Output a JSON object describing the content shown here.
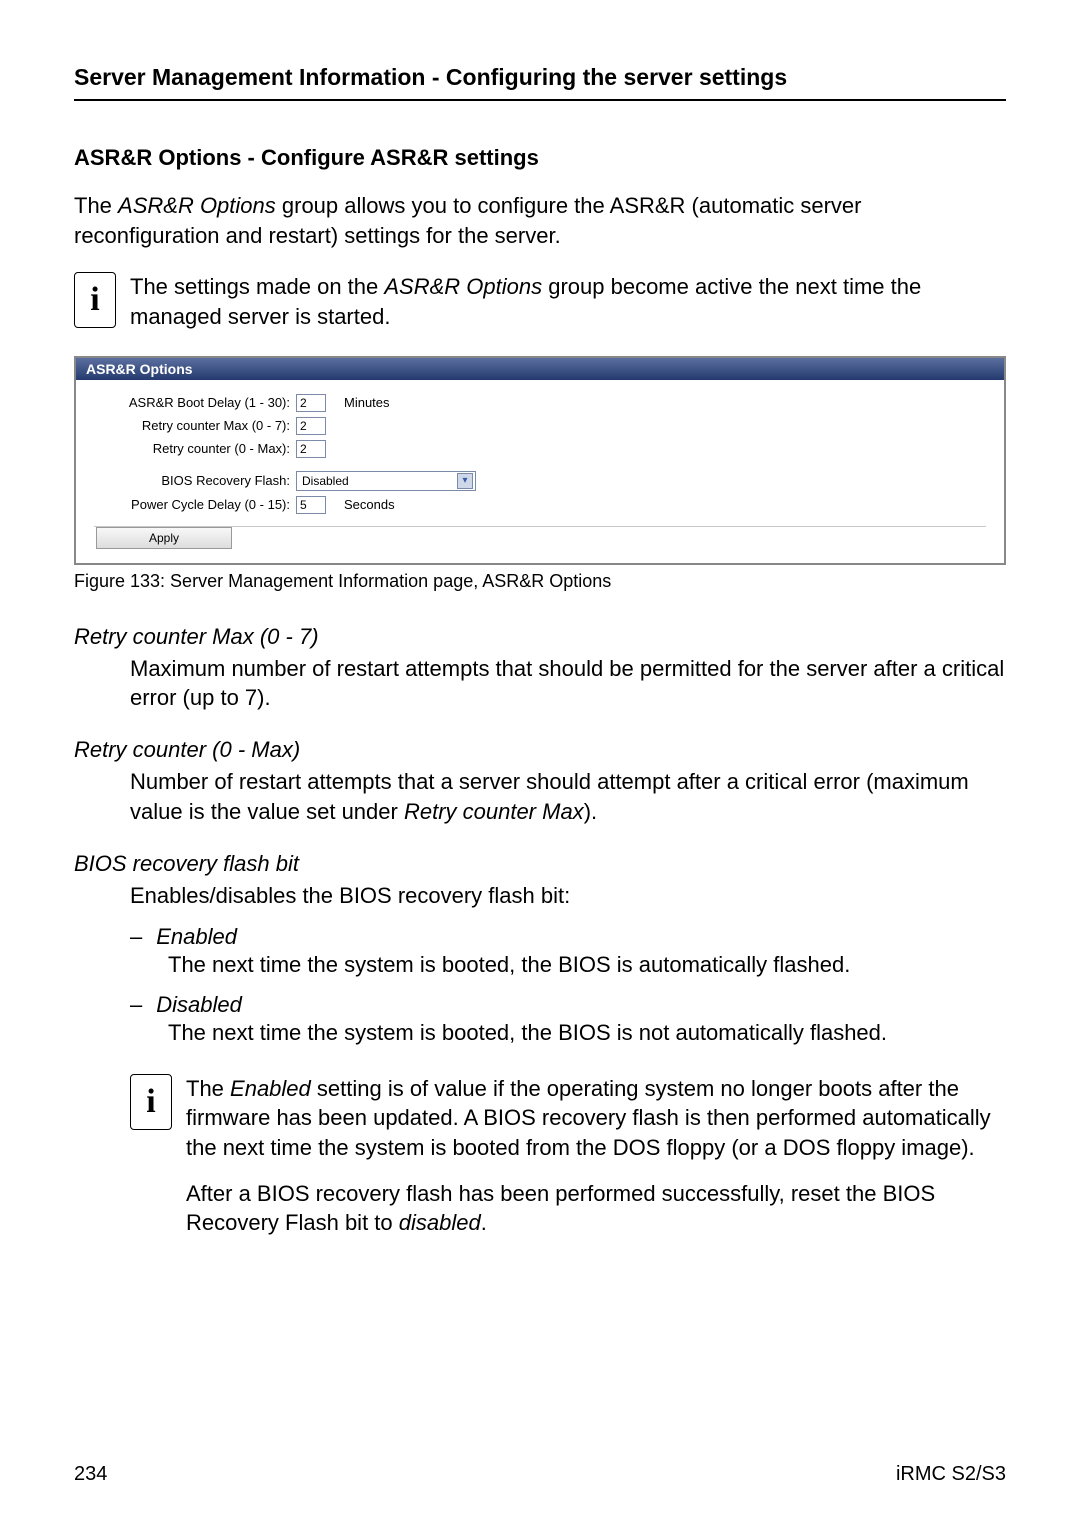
{
  "header": {
    "title": "Server Management Information - Configuring the server settings"
  },
  "section": {
    "title": "ASR&R Options - Configure ASR&R settings"
  },
  "intro": {
    "lead": "The ",
    "italic": "ASR&R Options",
    "rest": "  group allows you to configure the ASR&R (automatic server reconfiguration and restart) settings for the server."
  },
  "note1": {
    "pre": "The settings made on the ",
    "italic": "ASR&R Options",
    "post": " group become active the next time the managed server is started."
  },
  "figure": {
    "titlebar": "ASR&R Options",
    "rows": {
      "boot_delay_label": "ASR&R Boot Delay (1 - 30):",
      "boot_delay_value": "2",
      "boot_delay_unit": "Minutes",
      "retry_max_label": "Retry counter Max (0 - 7):",
      "retry_max_value": "2",
      "retry_label": "Retry counter (0 - Max):",
      "retry_value": "2",
      "bios_label": "BIOS Recovery Flash:",
      "bios_value": "Disabled",
      "power_label": "Power Cycle Delay (0 - 15):",
      "power_value": "5",
      "power_unit": "Seconds"
    },
    "apply": "Apply"
  },
  "caption": "Figure 133: Server Management Information page, ASR&R Options",
  "terms": {
    "retry_max": {
      "label": "Retry counter Max (0 - 7)",
      "def": "Maximum number of restart attempts that should be permitted for the server after a critical error (up to 7)."
    },
    "retry": {
      "label": "Retry counter (0 - Max)",
      "def_pre": "Number of restart attempts that a server should attempt after a critical error (maximum value is the value set under ",
      "def_italic": "Retry counter Max",
      "def_post": ")."
    },
    "bios": {
      "label": "BIOS recovery flash bit",
      "def": "Enables/disables the BIOS recovery flash bit:",
      "enabled_label": "Enabled",
      "enabled_text": "The next time the system is booted, the BIOS is automatically flashed.",
      "disabled_label": "Disabled",
      "disabled_text": "The next time the system is booted, the BIOS is not automatically flashed.",
      "note_pre": "The ",
      "note_italic1": "Enabled",
      "note_mid": " setting is of value if the operating system no longer boots after the firmware has been updated. A BIOS recovery flash is then performed automatically the next time the system is booted from the DOS floppy (or a DOS floppy image).",
      "note2_pre": "After a BIOS recovery flash has been performed successfully, reset the BIOS Recovery Flash bit to ",
      "note2_italic": "disabled",
      "note2_post": "."
    }
  },
  "footer": {
    "page": "234",
    "right": "iRMC S2/S3"
  }
}
